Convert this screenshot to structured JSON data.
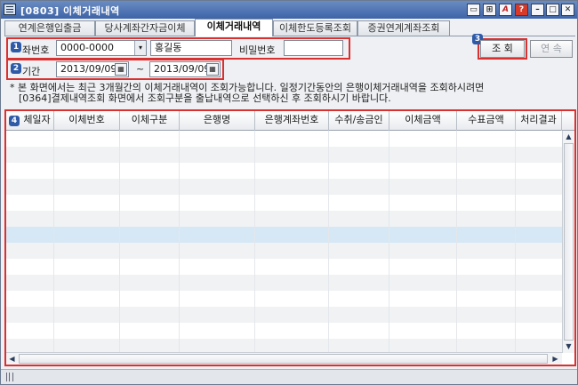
{
  "window": {
    "title": "[0803] 이체거래내역"
  },
  "titlebar_buttons": [
    {
      "name": "window-icon",
      "glyph": "▭"
    },
    {
      "name": "pin-icon",
      "glyph": "⊞"
    },
    {
      "name": "font-icon",
      "glyph": "A"
    },
    {
      "name": "help-icon",
      "glyph": "?"
    },
    {
      "name": "minimize-icon",
      "glyph": "–"
    },
    {
      "name": "maximize-icon",
      "glyph": "□"
    },
    {
      "name": "close-icon",
      "glyph": "✕"
    }
  ],
  "tabs": [
    {
      "label": "연계은행입출금"
    },
    {
      "label": "당사계좌간자금이체"
    },
    {
      "label": "이체거래내역",
      "active": true
    },
    {
      "label": "이체한도등록조회"
    },
    {
      "label": "증권연계계좌조회"
    }
  ],
  "markers": [
    "1",
    "2",
    "3",
    "4"
  ],
  "form": {
    "account_label": "좌번호",
    "account_value": "0000-0000",
    "dropdown_glyph": "▾",
    "name_value": "홍길동",
    "password_label": "비밀번호",
    "password_value": "",
    "period_label": "기간",
    "date_from": "2013/09/09",
    "date_sep": "~",
    "date_to": "2013/09/09",
    "calendar_glyph": "▦"
  },
  "buttons": {
    "search": "조 회",
    "next": "연 속"
  },
  "notice": {
    "line1": "* 본 화면에서는 최근 3개월간의 이체거래내역이 조회가능합니다. 일정기간동안의 은행이체거래내역을 조회하시려면",
    "line2": "[0364]결제내역조회 화면에서 조회구분을 출납내역으로 선택하신 후 조회하시기 바랍니다."
  },
  "grid": {
    "columns": [
      "체일자",
      "이체번호",
      "이체구분",
      "은행명",
      "은행계좌번호",
      "수취/송금인",
      "이체금액",
      "수표금액",
      "처리결과"
    ],
    "row_count": 7,
    "highlighted_row": 3
  },
  "scroll_glyphs": {
    "up": "▲",
    "down": "▼",
    "left": "◀",
    "right": "▶"
  },
  "colors": {
    "highlight_row": "#d6e8f5",
    "alt_row": "#f0f2f4",
    "marker_box": "#d93030"
  }
}
